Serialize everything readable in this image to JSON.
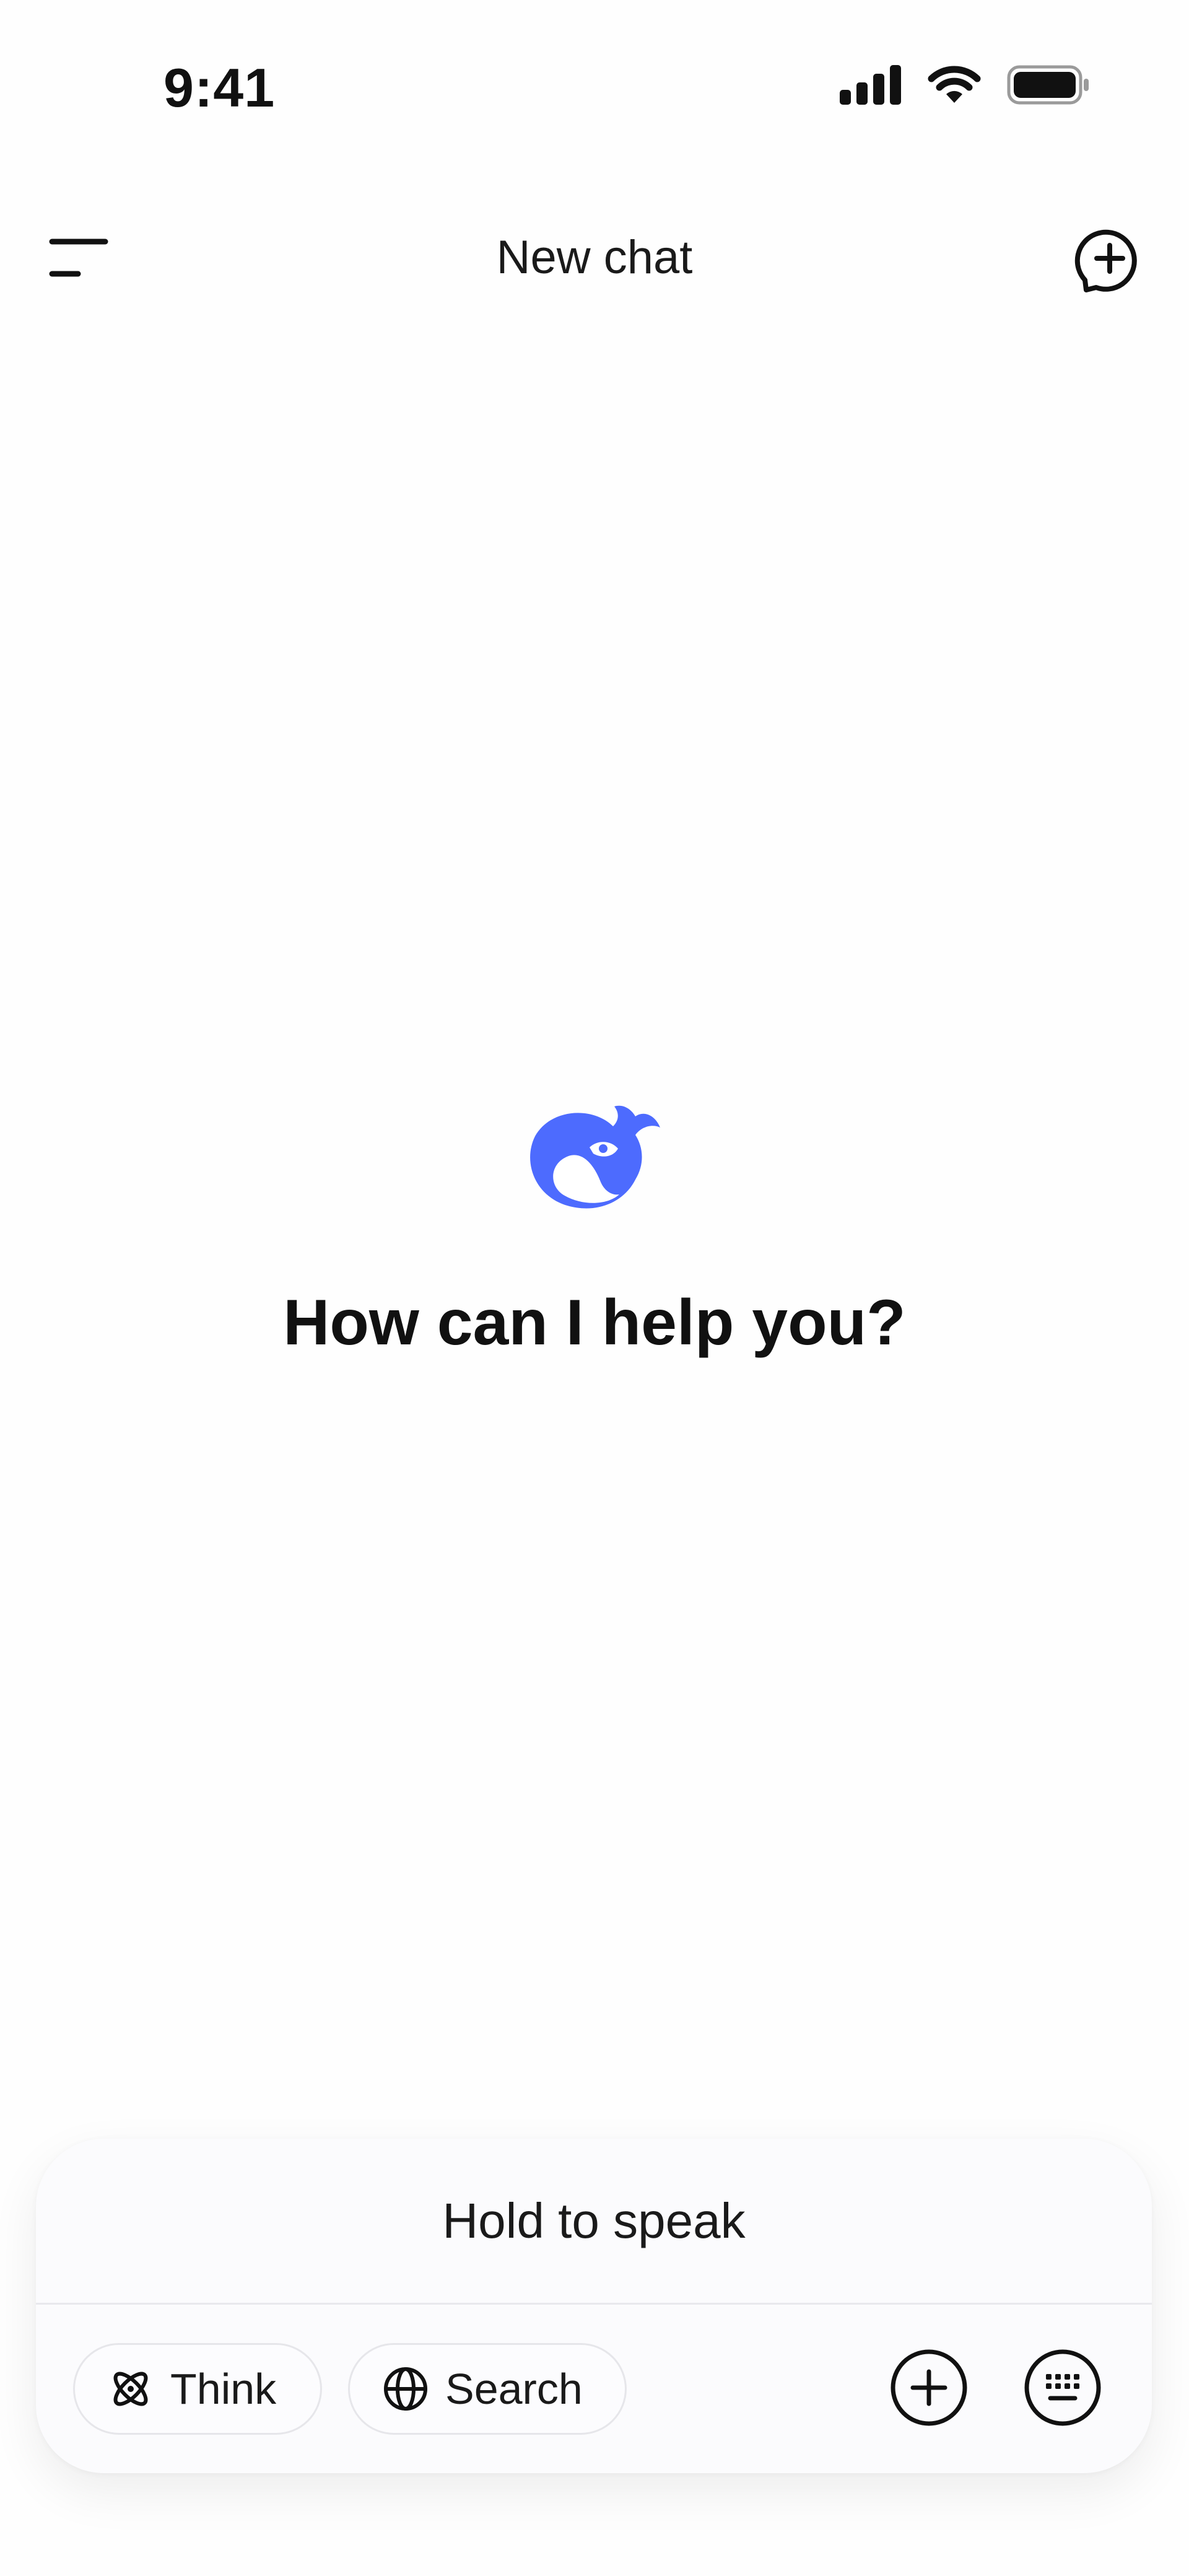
{
  "status_bar": {
    "time": "9:41",
    "icons": [
      "cellular-signal-icon",
      "wifi-icon",
      "battery-icon"
    ]
  },
  "header": {
    "title": "New chat",
    "left_icon": "sidebar-menu-icon",
    "right_icon": "new-chat-icon"
  },
  "main": {
    "logo_icon": "whale-logo-icon",
    "greeting": "How can I help you?"
  },
  "composer": {
    "voice_label": "Hold to speak",
    "chips": [
      {
        "label": "Think",
        "icon": "atom-icon"
      },
      {
        "label": "Search",
        "icon": "globe-icon"
      }
    ],
    "actions": [
      {
        "name": "attach-button",
        "icon": "plus-circle-icon"
      },
      {
        "name": "keyboard-button",
        "icon": "keyboard-icon"
      }
    ]
  },
  "colors": {
    "brand": "#4d6bfe",
    "text": "#111111",
    "background": "#fefefe",
    "composer_bg": "#fbfbfd",
    "chip_border": "#e6e6ea"
  }
}
